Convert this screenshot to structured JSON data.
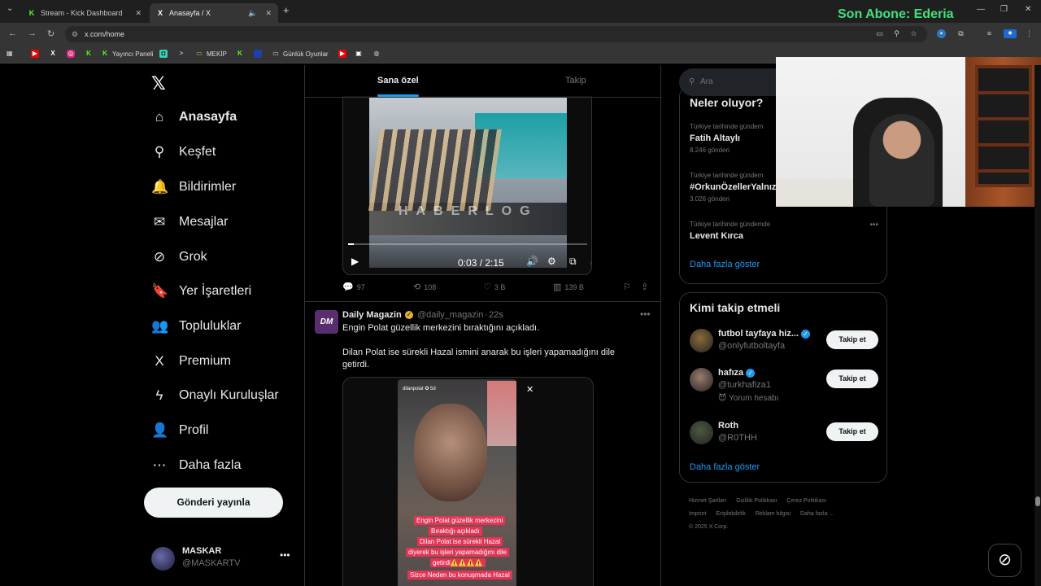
{
  "browser": {
    "tabs": [
      {
        "label": "Stream - Kick Dashboard",
        "icon": "kick-icon"
      },
      {
        "label": "Anasayfa / X",
        "icon": "x-icon"
      }
    ],
    "new_tab": "+",
    "address": "x.com/home",
    "overlay_text": "Son Abone: Ederia",
    "bookmarks": {
      "yayinci": "Yayıncı Paneli",
      "mekip": "MEKİP",
      "gunluk": "Günlük Oyunlar"
    }
  },
  "nav": {
    "items": [
      {
        "label": "Anasayfa",
        "icon": "home-icon",
        "glyph": "⌂"
      },
      {
        "label": "Keşfet",
        "icon": "search-icon",
        "glyph": "⚲"
      },
      {
        "label": "Bildirimler",
        "icon": "bell-icon",
        "glyph": "🔔"
      },
      {
        "label": "Mesajlar",
        "icon": "mail-icon",
        "glyph": "✉"
      },
      {
        "label": "Grok",
        "icon": "grok-icon",
        "glyph": "⊘"
      },
      {
        "label": "Yer İşaretleri",
        "icon": "bookmark-icon",
        "glyph": "🔖"
      },
      {
        "label": "Topluluklar",
        "icon": "communities-icon",
        "glyph": "👥"
      },
      {
        "label": "Premium",
        "icon": "x-premium-icon",
        "glyph": "X"
      },
      {
        "label": "Onaylı Kuruluşlar",
        "icon": "lightning-icon",
        "glyph": "ϟ"
      },
      {
        "label": "Profil",
        "icon": "person-icon",
        "glyph": "👤"
      },
      {
        "label": "Daha fazla",
        "icon": "more-circle-icon",
        "glyph": "⋯"
      }
    ],
    "post_button": "Gönderi yayınla",
    "profile": {
      "name": "MASKAR",
      "handle": "@MASKARTV"
    }
  },
  "feed": {
    "tabs": {
      "for_you": "Sana özel",
      "following": "Takip"
    },
    "video1": {
      "watermark": "HABERLOG",
      "time": "0:03 / 2:15",
      "progress": 0.023
    },
    "actions1": {
      "replies": "97",
      "reposts": "108",
      "likes": "3 B",
      "views": "139 B"
    },
    "tweet2": {
      "avatar_text": "DM",
      "name": "Daily Magazin",
      "handle": "@daily_magazin",
      "time": "22s",
      "text1": "Engin Polat güzellik merkezini bıraktığını açıkladı.",
      "text2": " Dilan Polat ise sürekli Hazal ismini anarak bu işleri yapamadığını dile getirdi.",
      "story_user": "dilanpolat ✪ 5d",
      "captions": [
        "Engin Polat güzellik merkezini",
        "Bıraktığı açıkladı",
        "Dilan Polat ise sürekli  Hazal",
        "diyerek bu işleri yapamadığını dile",
        "getirdi⚠️⚠️⚠️⚠️",
        "Sizce Neden bu konuşmada Hazal"
      ]
    }
  },
  "right": {
    "search_placeholder": "Ara",
    "trends_title": "Neler oluyor?",
    "trends": [
      {
        "context": "Türkiye tarihinde gündem",
        "name": "Fatih Altaylı",
        "count": "8.246 gönderi"
      },
      {
        "context": "Türkiye tarihinde gündem",
        "name": "#OrkunÖzellerYalnız",
        "count": "3.026 gönderi"
      },
      {
        "context": "Türkiye tarihinde gündemde",
        "name": "Levent Kırca",
        "count": ""
      }
    ],
    "trends_more": "Daha fazla göster",
    "who_title": "Kimi takip etmeli",
    "who": [
      {
        "name": "futbol tayfaya hiz...",
        "handle": "@onlyfutboltayfa",
        "sub": "",
        "button": "Takip et",
        "verified": true,
        "avatar_color": "#8a6a3a"
      },
      {
        "name": "hafıza",
        "handle": "@turkhafiza1",
        "sub": "😈 Yorum hesabı",
        "button": "Takip et",
        "verified": true,
        "avatar_color": "#9b7d6c"
      },
      {
        "name": "Roth",
        "handle": "@R0THH",
        "sub": "",
        "button": "Takip et",
        "verified": false,
        "avatar_color": "#4c5a40"
      }
    ],
    "who_more": "Daha fazla göster",
    "footer": [
      "Hizmet Şartları",
      "Gizlilik Politikası",
      "Çerez Politikası",
      "Imprint",
      "Erişilebilirlik",
      "Reklam bilgisi",
      "Daha fazla ...",
      "© 2025 X Corp."
    ]
  }
}
